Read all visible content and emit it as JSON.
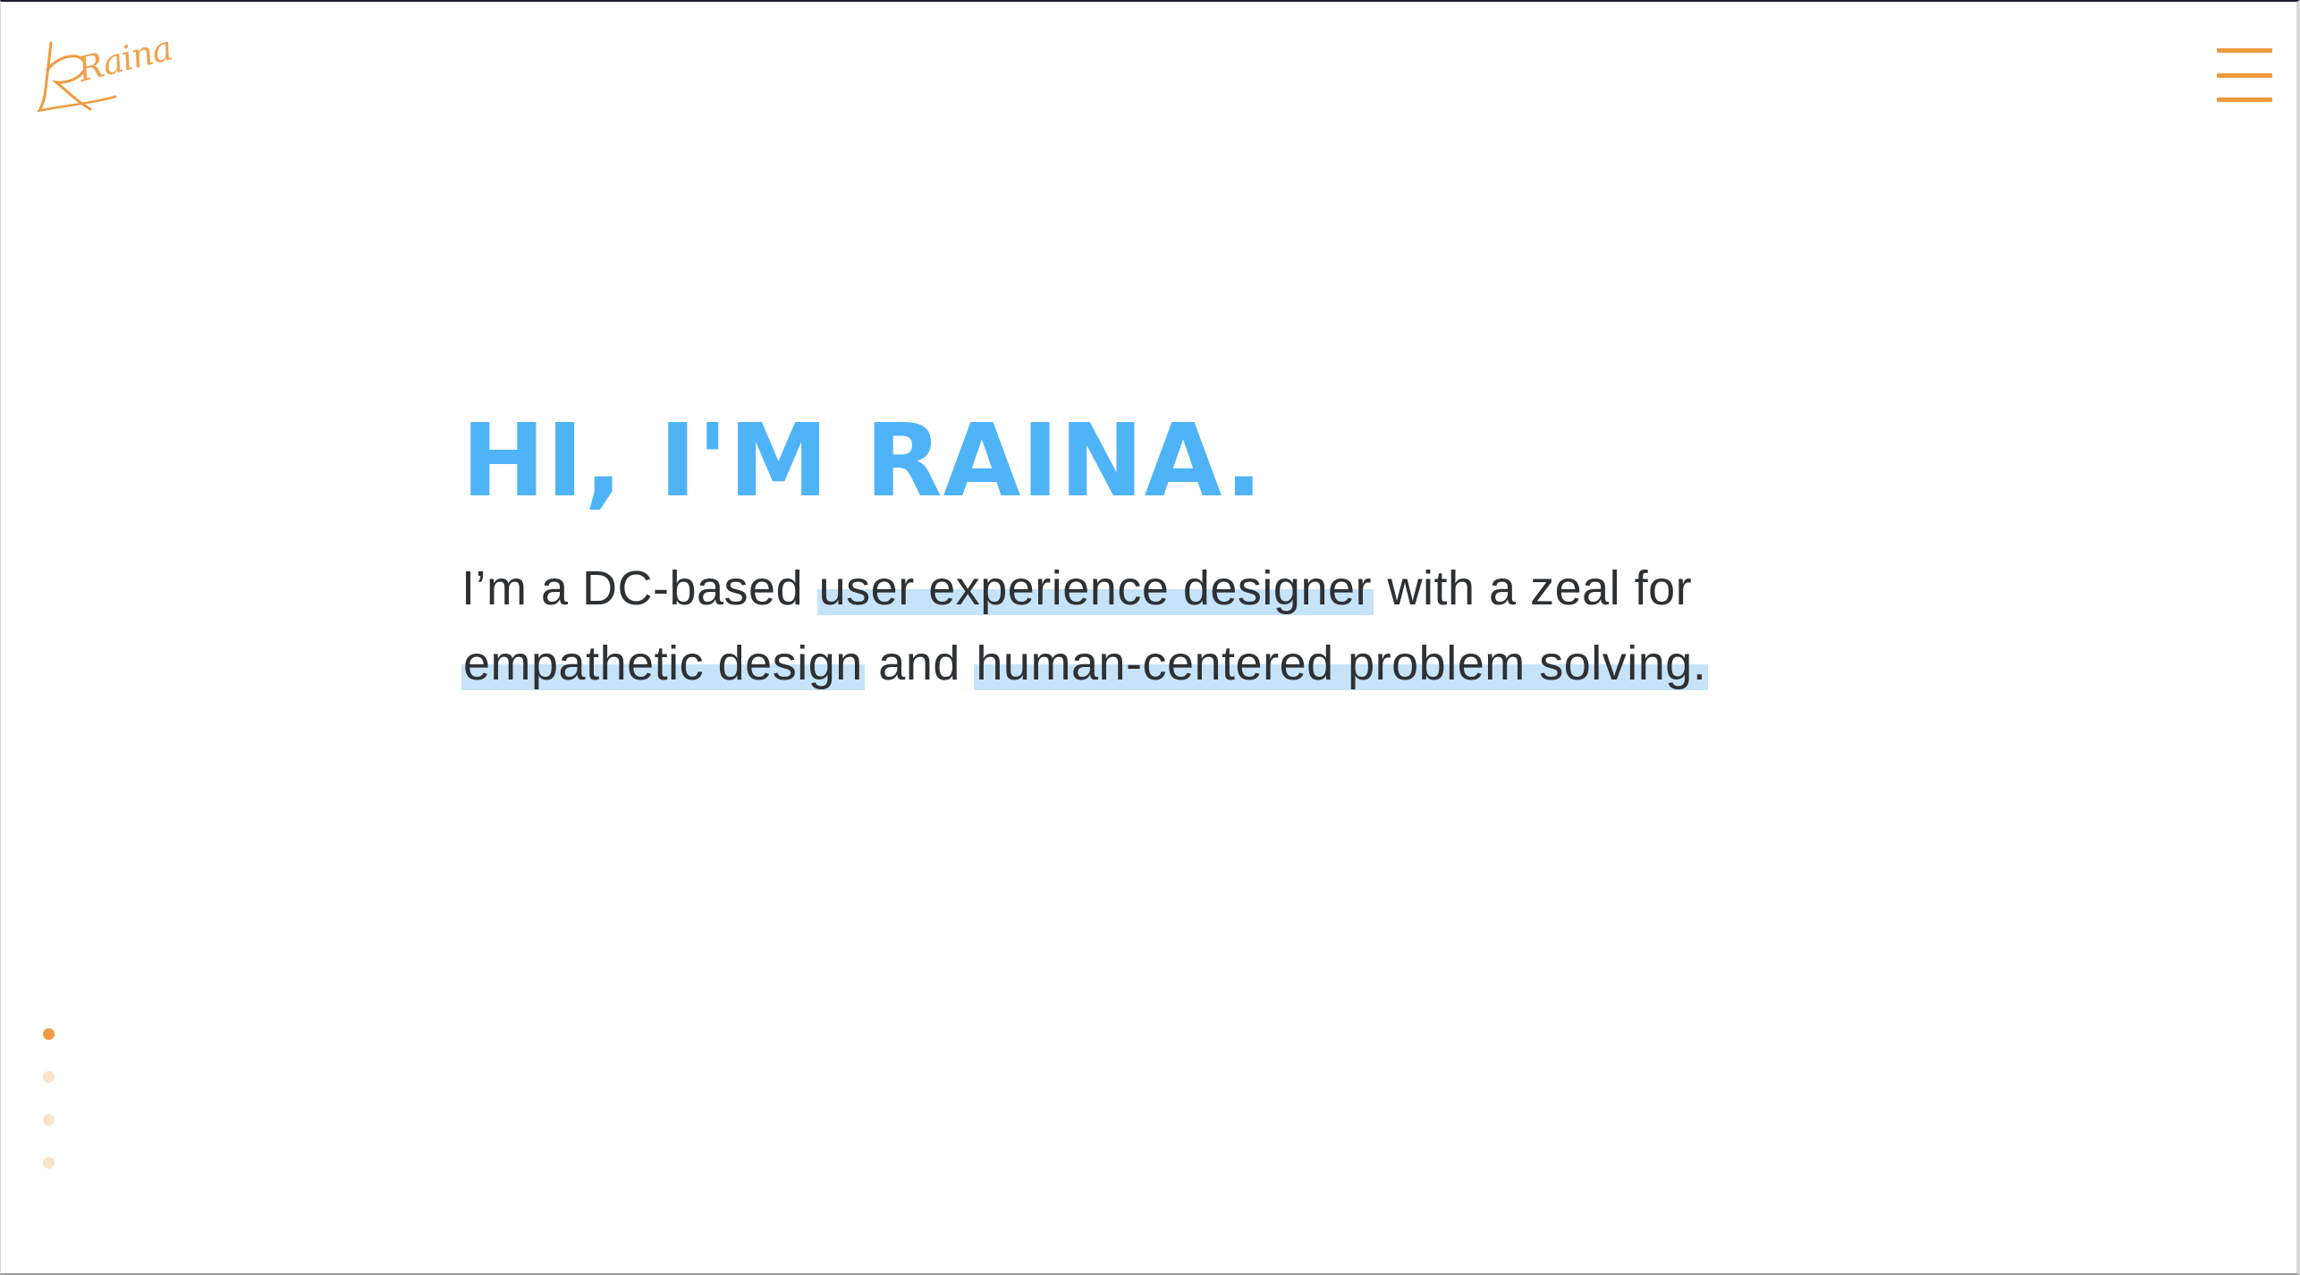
{
  "logo": {
    "text": "Raina"
  },
  "menu": {
    "icon": "hamburger-menu-icon"
  },
  "hero": {
    "title": "HI, I'M RAINA.",
    "text_intro": "I’m a DC-based ",
    "highlight_1": "user experience designer",
    "text_mid_1": " with a zeal for ",
    "highlight_2": "empathetic design",
    "text_mid_2": " and ",
    "highlight_3": "human-centered problem solving",
    "text_end": "."
  },
  "section_nav": {
    "count": 4,
    "active_index": 0
  },
  "colors": {
    "accent": "#ee9a3f",
    "heading": "#4eb3f7",
    "highlight": "#c6e3fa",
    "body_text": "#2e3133",
    "dot_inactive": "#fbe3cb"
  }
}
